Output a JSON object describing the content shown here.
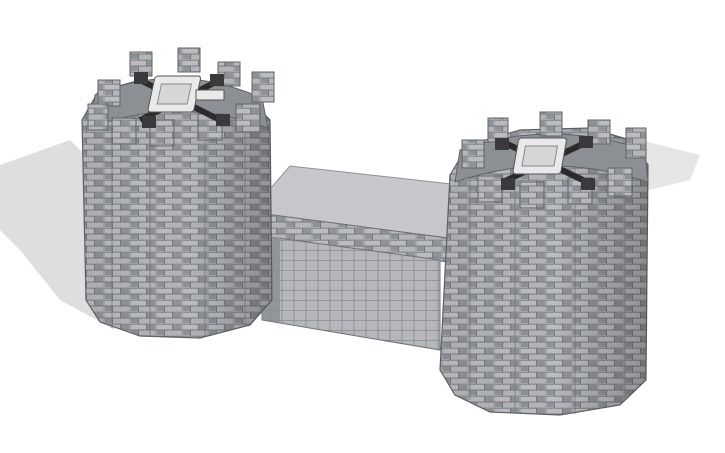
{
  "colors": {
    "background": "#ffffff",
    "shadow": "#dedede",
    "stone_light": "#b9bbbe",
    "stone_mid": "#a3a6aa",
    "stone_dark": "#7d8085",
    "mortar": "#5f6368",
    "bridge_top": "#c4c6c9",
    "gate_dark": "#8a8d91",
    "drone_body": "#e9e9e9",
    "drone_arm": "#2b2b2b"
  },
  "icons": {
    "left_tower": "stone-tower-icon",
    "right_tower": "stone-tower-icon",
    "bridge": "bridge-icon",
    "drone": "quadcopter-drone-icon"
  }
}
